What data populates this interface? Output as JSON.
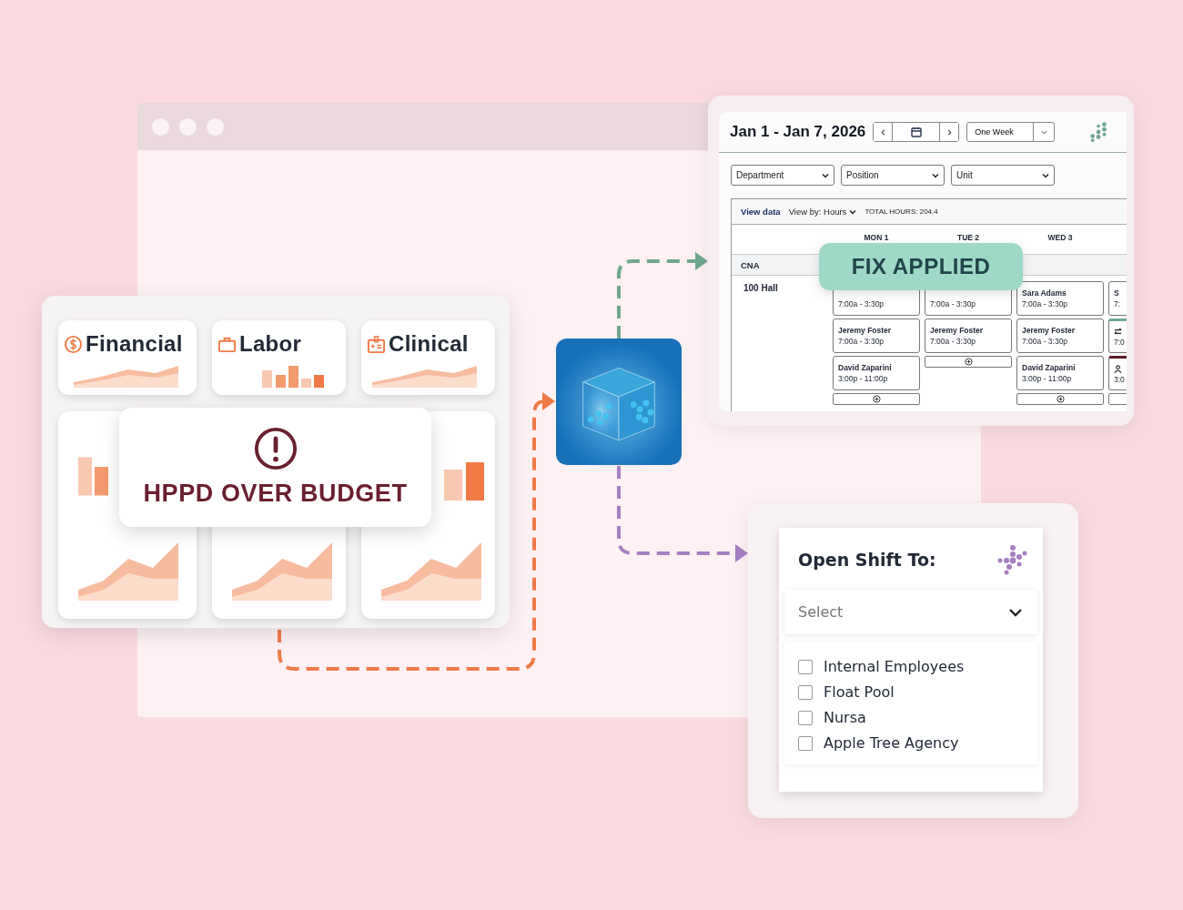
{
  "dashboard": {
    "tiles": [
      {
        "title": "Financial",
        "kind": "line"
      },
      {
        "title": "Labor",
        "kind": "bars"
      },
      {
        "title": "Clinical",
        "kind": "line"
      }
    ],
    "alert": "HPPD OVER BUDGET"
  },
  "schedule": {
    "date_range": "Jan 1 - Jan 7, 2026",
    "view": "One Week",
    "filters": [
      "Department",
      "Position",
      "Unit"
    ],
    "view_data": "View data",
    "view_by": "View by: Hours",
    "total": "TOTAL HOURS: 204.4",
    "days": [
      "MON 1",
      "TUE 2",
      "WED 3"
    ],
    "group": "CNA",
    "unit": "100 Hall",
    "columns": [
      {
        "add_button": true,
        "shifts": [
          {
            "kind": "plain",
            "time": "7:00a - 3:30p"
          },
          {
            "kind": "plain",
            "name": "Jeremy Foster",
            "time": "7:00a - 3:30p"
          },
          {
            "kind": "plain",
            "name": "David Zaparini",
            "time": "3:00p - 11:00p"
          }
        ]
      },
      {
        "add_button": true,
        "shifts": [
          {
            "kind": "plain",
            "time": "7:00a - 3:30p"
          },
          {
            "kind": "plain",
            "name": "Jeremy Foster",
            "time": "7:00a - 3:30p"
          }
        ]
      },
      {
        "add_button": true,
        "shifts": [
          {
            "kind": "plain",
            "name": "Sara Adams",
            "time": "7:00a - 3:30p"
          },
          {
            "kind": "plain",
            "name": "Jeremy Foster",
            "time": "7:00a - 3:30p"
          },
          {
            "kind": "plain",
            "name": "David Zaparini",
            "time": "3:00p - 11:00p"
          }
        ]
      },
      {
        "add_button": true,
        "shifts": [
          {
            "kind": "plain",
            "name": "S",
            "time": "7:"
          },
          {
            "kind": "swap",
            "time": "7:0"
          },
          {
            "kind": "person",
            "time": "3:0"
          }
        ]
      }
    ]
  },
  "badge": "FIX APPLIED",
  "open_shift": {
    "title": "Open Shift To:",
    "select": {
      "placeholder": "Select"
    },
    "options": [
      {
        "label": "Internal Employees",
        "checked": false
      },
      {
        "label": "Float Pool",
        "checked": false
      },
      {
        "label": "Nursa",
        "checked": false
      },
      {
        "label": "Apple Tree Agency",
        "checked": false
      }
    ]
  }
}
